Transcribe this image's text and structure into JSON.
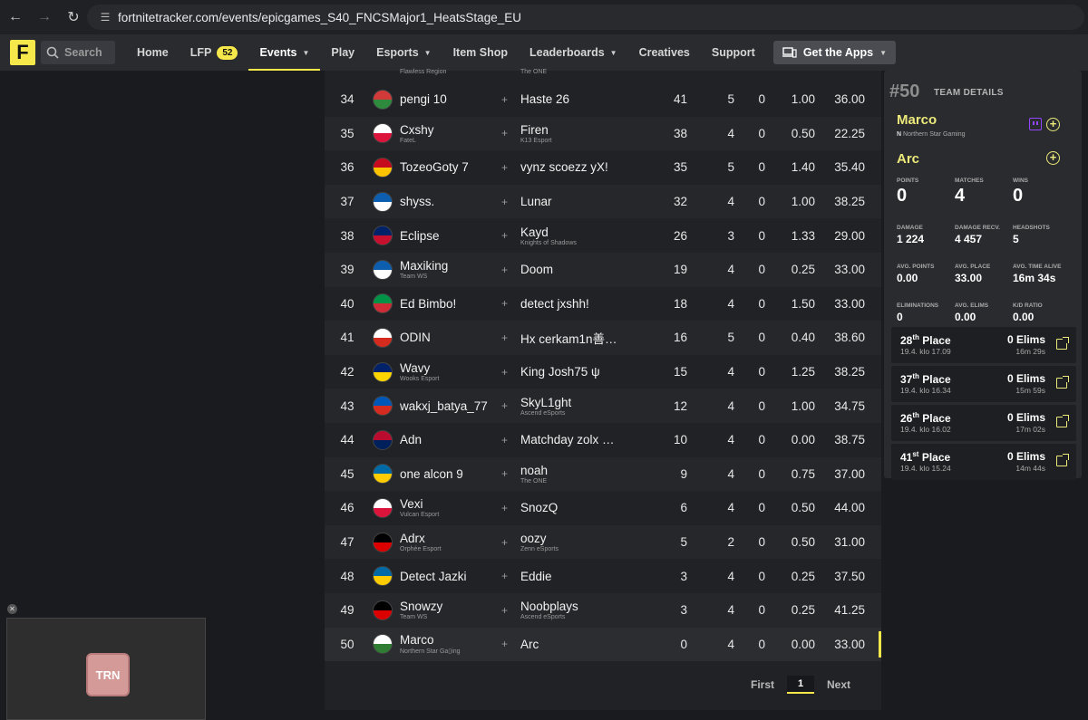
{
  "browser": {
    "url": "fortnitetracker.com/events/epicgames_S40_FNCSMajor1_HeatsStage_EU"
  },
  "nav": {
    "search_placeholder": "Search",
    "items": [
      {
        "label": "Home"
      },
      {
        "label": "LFP",
        "badge": "52"
      },
      {
        "label": "Events",
        "active": true
      },
      {
        "label": "Play"
      },
      {
        "label": "Esports"
      },
      {
        "label": "Item Shop"
      },
      {
        "label": "Leaderboards"
      },
      {
        "label": "Creatives"
      },
      {
        "label": "Support"
      }
    ],
    "apps_label": "Get the Apps"
  },
  "table": {
    "top_cut": {
      "p1_team": "Flawless Region",
      "p2_team": "The ONE"
    },
    "rows": [
      {
        "rank": "34",
        "p1": "pengi 10",
        "t1": "",
        "p2": "Haste 26",
        "t2": "",
        "pts": "41",
        "m": "5",
        "w": "0",
        "kd": "1.00",
        "last": "36.00"
      },
      {
        "rank": "35",
        "p1": "Cxshy",
        "t1": "FateL",
        "p2": "Firen",
        "t2": "K13 Esport",
        "pts": "38",
        "m": "4",
        "w": "0",
        "kd": "0.50",
        "last": "22.25"
      },
      {
        "rank": "36",
        "p1": "TozeoGoty 7",
        "t1": "",
        "p2": "vynz scoezz yX!",
        "t2": "",
        "pts": "35",
        "m": "5",
        "w": "0",
        "kd": "1.40",
        "last": "35.40"
      },
      {
        "rank": "37",
        "p1": "shyss.",
        "t1": "",
        "p2": "Lunar",
        "t2": "",
        "pts": "32",
        "m": "4",
        "w": "0",
        "kd": "1.00",
        "last": "38.25"
      },
      {
        "rank": "38",
        "p1": "Eclipse",
        "t1": "",
        "p2": "Kayd",
        "t2": "Knights of Shadows",
        "pts": "26",
        "m": "3",
        "w": "0",
        "kd": "1.33",
        "last": "29.00"
      },
      {
        "rank": "39",
        "p1": "Maxiking",
        "t1": "Team WS",
        "p2": "Doom",
        "t2": "",
        "pts": "19",
        "m": "4",
        "w": "0",
        "kd": "0.25",
        "last": "33.00"
      },
      {
        "rank": "40",
        "p1": "Ed Bimbo!",
        "t1": "",
        "p2": "detect jxshh!",
        "t2": "",
        "pts": "18",
        "m": "4",
        "w": "0",
        "kd": "1.50",
        "last": "33.00"
      },
      {
        "rank": "41",
        "p1": "ODIN",
        "t1": "",
        "p2": "Hx cerkam1n善…",
        "t2": "",
        "pts": "16",
        "m": "5",
        "w": "0",
        "kd": "0.40",
        "last": "38.60"
      },
      {
        "rank": "42",
        "p1": "Wavy",
        "t1": "Wooks Esport",
        "p2": "King Josh75 ψ",
        "t2": "",
        "pts": "15",
        "m": "4",
        "w": "0",
        "kd": "1.25",
        "last": "38.25"
      },
      {
        "rank": "43",
        "p1": "wakxj_batya_77",
        "t1": "",
        "p2": "SkyL1ght",
        "t2": "Ascend eSports",
        "pts": "12",
        "m": "4",
        "w": "0",
        "kd": "1.00",
        "last": "34.75"
      },
      {
        "rank": "44",
        "p1": "Adn",
        "t1": "",
        "p2": "Matchday zolx …",
        "t2": "",
        "pts": "10",
        "m": "4",
        "w": "0",
        "kd": "0.00",
        "last": "38.75"
      },
      {
        "rank": "45",
        "p1": "one alcon 9",
        "t1": "",
        "p2": "noah",
        "t2": "The ONE",
        "pts": "9",
        "m": "4",
        "w": "0",
        "kd": "0.75",
        "last": "37.00"
      },
      {
        "rank": "46",
        "p1": "Vexi",
        "t1": "Vulcan Esport",
        "p2": "SnozQ",
        "t2": "",
        "pts": "6",
        "m": "4",
        "w": "0",
        "kd": "0.50",
        "last": "44.00"
      },
      {
        "rank": "47",
        "p1": "Adrx",
        "t1": "Orphée Esport",
        "p2": "oozy",
        "t2": "Zenn eSports",
        "pts": "5",
        "m": "2",
        "w": "0",
        "kd": "0.50",
        "last": "31.00"
      },
      {
        "rank": "48",
        "p1": "Detect Jazki",
        "t1": "",
        "p2": "Eddie",
        "t2": "",
        "pts": "3",
        "m": "4",
        "w": "0",
        "kd": "0.25",
        "last": "37.50"
      },
      {
        "rank": "49",
        "p1": "Snowzy",
        "t1": "Team WS",
        "p2": "Noobplays",
        "t2": "Ascend eSports",
        "pts": "3",
        "m": "4",
        "w": "0",
        "kd": "0.25",
        "last": "41.25"
      },
      {
        "rank": "50",
        "p1": "Marco",
        "t1": "Northern Star Ga▯ing",
        "p2": "Arc",
        "t2": "",
        "pts": "0",
        "m": "4",
        "w": "0",
        "kd": "0.00",
        "last": "33.00"
      }
    ],
    "flags": [
      "#d23a3a,#2e8b3d",
      "#ffffff,#dc143c",
      "#c60b1e,#ffc400",
      "#0d5eaf,#ffffff",
      "#012169,#c8102e",
      "#0d5eaf,#ffffff",
      "#009246,#ce2b37",
      "#ffffff,#d52b1e",
      "#012169,#ffd500",
      "#0057b7,#d52b1e",
      "#ba0c2f,#00205b",
      "#006aa7,#fecc00",
      "#ffffff,#dc143c",
      "#000000,#dd0000",
      "#006aa7,#fecc00",
      "#000000,#dd0000",
      "#ffffff,#2e7d32"
    ],
    "pager": {
      "first": "First",
      "current": "1",
      "next": "Next"
    }
  },
  "details": {
    "rank": "#50",
    "title": "TEAM DETAILS",
    "members": [
      {
        "name": "Marco",
        "team": "Northern Star Gaming"
      },
      {
        "name": "Arc",
        "team": ""
      }
    ],
    "stats1": [
      {
        "label": "Points",
        "value": "0"
      },
      {
        "label": "Matches",
        "value": "4"
      },
      {
        "label": "Wins",
        "value": "0"
      }
    ],
    "stats2": [
      {
        "label": "Damage",
        "value": "1 224"
      },
      {
        "label": "Damage Recv.",
        "value": "4 457"
      },
      {
        "label": "Headshots",
        "value": "5"
      },
      {
        "label": "Avg. Points",
        "value": "0.00"
      },
      {
        "label": "Avg. Place",
        "value": "33.00"
      },
      {
        "label": "Avg. Time Alive",
        "value": "16m 34s"
      },
      {
        "label": "Eliminations",
        "value": "0"
      },
      {
        "label": "Avg. Elims",
        "value": "0.00"
      },
      {
        "label": "K/D Ratio",
        "value": "0.00"
      }
    ],
    "matches": [
      {
        "place": "28",
        "suffix": "th",
        "label": "Place",
        "date": "19.4. klo 17.09",
        "elims": "0 Elims",
        "time": "16m 29s"
      },
      {
        "place": "37",
        "suffix": "th",
        "label": "Place",
        "date": "19.4. klo 16.34",
        "elims": "0 Elims",
        "time": "15m 59s"
      },
      {
        "place": "26",
        "suffix": "th",
        "label": "Place",
        "date": "19.4. klo 16.02",
        "elims": "0 Elims",
        "time": "17m 02s"
      },
      {
        "place": "41",
        "suffix": "st",
        "label": "Place",
        "date": "19.4. klo 15.24",
        "elims": "0 Elims",
        "time": "14m 44s"
      }
    ]
  },
  "pip": {
    "logo_text": "TRN"
  }
}
